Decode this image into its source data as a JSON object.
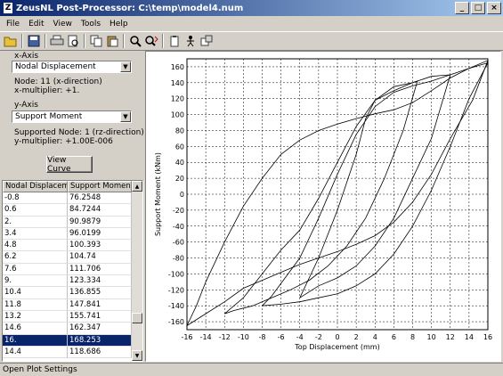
{
  "window": {
    "title": "ZeusNL Post-Processor: C:\\temp\\model4.num",
    "app_icon_text": "Z"
  },
  "menu": [
    "File",
    "Edit",
    "View",
    "Tools",
    "Help"
  ],
  "toolbar_icons": [
    "open-folder-icon",
    "save-icon",
    "print-icon",
    "print-preview-icon",
    "copy-icon",
    "paste-icon",
    "zoom-icon",
    "zoom-reset-icon",
    "clipboard-icon",
    "person-icon",
    "settings-icon"
  ],
  "xaxis": {
    "label": "x-Axis",
    "selected": "Nodal Displacement",
    "info1": "Node: 11 (x-direction)",
    "info2": "x-multiplier: +1."
  },
  "yaxis": {
    "label": "y-Axis",
    "selected": "Support Moment",
    "info1": "Supported Node: 1 (rz-direction)",
    "info2": "y-multiplier: +1.00E-006"
  },
  "view_button": "View Curve",
  "table": {
    "headers": [
      "Nodal Displacement",
      "Support Moment"
    ],
    "rows": [
      [
        "-0.8",
        "76.2548"
      ],
      [
        "0.6",
        "84.7244"
      ],
      [
        "2.",
        "90.9879"
      ],
      [
        "3.4",
        "96.0199"
      ],
      [
        "4.8",
        "100.393"
      ],
      [
        "6.2",
        "104.74"
      ],
      [
        "7.6",
        "111.706"
      ],
      [
        "9.",
        "123.334"
      ],
      [
        "10.4",
        "136.855"
      ],
      [
        "11.8",
        "147.841"
      ],
      [
        "13.2",
        "155.741"
      ],
      [
        "14.6",
        "162.347"
      ],
      [
        "16.",
        "168.253"
      ],
      [
        "14.4",
        "118.686"
      ]
    ],
    "selected_index": 12
  },
  "chart_data": {
    "type": "line",
    "title": "",
    "xlabel": "Top Displacement (mm)",
    "ylabel": "Support Moment (kNm)",
    "xlim": [
      -16,
      16
    ],
    "ylim": [
      -170,
      170
    ],
    "xticks": [
      -16,
      -14,
      -12,
      -10,
      -8,
      -6,
      -4,
      -2,
      0,
      2,
      4,
      6,
      8,
      10,
      12,
      14,
      16
    ],
    "yticks": [
      -160,
      -140,
      -120,
      -100,
      -80,
      -60,
      -40,
      -20,
      0,
      20,
      40,
      60,
      80,
      100,
      120,
      140,
      160
    ],
    "grid": true,
    "series": [
      {
        "points": [
          [
            -16,
            -165
          ],
          [
            -15,
            -140
          ],
          [
            -14,
            -110
          ],
          [
            -12,
            -60
          ],
          [
            -10,
            -15
          ],
          [
            -8,
            20
          ],
          [
            -6,
            50
          ],
          [
            -4,
            68
          ],
          [
            -2,
            80
          ],
          [
            0,
            88
          ],
          [
            2,
            95
          ],
          [
            4,
            101
          ],
          [
            6,
            106
          ],
          [
            8,
            115
          ],
          [
            10,
            130
          ],
          [
            12,
            146
          ],
          [
            14,
            158
          ],
          [
            16,
            168
          ],
          [
            14.4,
            118.7
          ],
          [
            12,
            70
          ],
          [
            10,
            25
          ],
          [
            8,
            -10
          ],
          [
            6,
            -35
          ],
          [
            4,
            -52
          ],
          [
            2,
            -63
          ],
          [
            0,
            -72
          ],
          [
            -2,
            -80
          ],
          [
            -4,
            -88
          ],
          [
            -6,
            -98
          ],
          [
            -8,
            -108
          ],
          [
            -10,
            -118
          ],
          [
            -12,
            -135
          ],
          [
            -14,
            -150
          ],
          [
            -16,
            -165
          ]
        ]
      },
      {
        "points": [
          [
            -12,
            -150
          ],
          [
            -10,
            -130
          ],
          [
            -8,
            -100
          ],
          [
            -6,
            -70
          ],
          [
            -4,
            -45
          ],
          [
            -2,
            -5
          ],
          [
            0,
            40
          ],
          [
            2,
            85
          ],
          [
            4,
            118
          ],
          [
            6,
            135
          ],
          [
            8,
            140
          ],
          [
            8.5,
            142
          ],
          [
            7,
            80
          ],
          [
            5,
            20
          ],
          [
            3,
            -30
          ],
          [
            1,
            -65
          ],
          [
            -1,
            -90
          ],
          [
            -3,
            -108
          ],
          [
            -5,
            -120
          ],
          [
            -7,
            -130
          ],
          [
            -9,
            -140
          ],
          [
            -11,
            -146
          ],
          [
            -12,
            -150
          ]
        ]
      },
      {
        "points": [
          [
            -8,
            -140
          ],
          [
            -7,
            -128
          ],
          [
            -6,
            -112
          ],
          [
            -4,
            -80
          ],
          [
            -2,
            -30
          ],
          [
            0,
            25
          ],
          [
            2,
            75
          ],
          [
            4,
            110
          ],
          [
            6,
            128
          ],
          [
            8,
            136
          ],
          [
            10,
            142
          ],
          [
            12,
            150
          ],
          [
            14,
            158
          ],
          [
            16,
            165
          ],
          [
            14,
            120
          ],
          [
            12,
            60
          ],
          [
            10,
            5
          ],
          [
            8,
            -40
          ],
          [
            6,
            -75
          ],
          [
            4,
            -100
          ],
          [
            2,
            -115
          ],
          [
            0,
            -125
          ],
          [
            -2,
            -130
          ],
          [
            -4,
            -135
          ],
          [
            -6,
            -138
          ],
          [
            -8,
            -140
          ]
        ]
      },
      {
        "points": [
          [
            -4,
            -130
          ],
          [
            -2,
            -80
          ],
          [
            0,
            -20
          ],
          [
            2,
            50
          ],
          [
            3,
            95
          ],
          [
            4,
            118
          ],
          [
            6,
            130
          ],
          [
            8,
            140
          ],
          [
            10,
            148
          ],
          [
            12,
            150
          ],
          [
            11,
            110
          ],
          [
            10,
            70
          ],
          [
            8,
            20
          ],
          [
            6,
            -30
          ],
          [
            4,
            -65
          ],
          [
            2,
            -90
          ],
          [
            0,
            -105
          ],
          [
            -2,
            -115
          ],
          [
            -4,
            -130
          ]
        ]
      }
    ]
  },
  "status": "Open Plot Settings"
}
